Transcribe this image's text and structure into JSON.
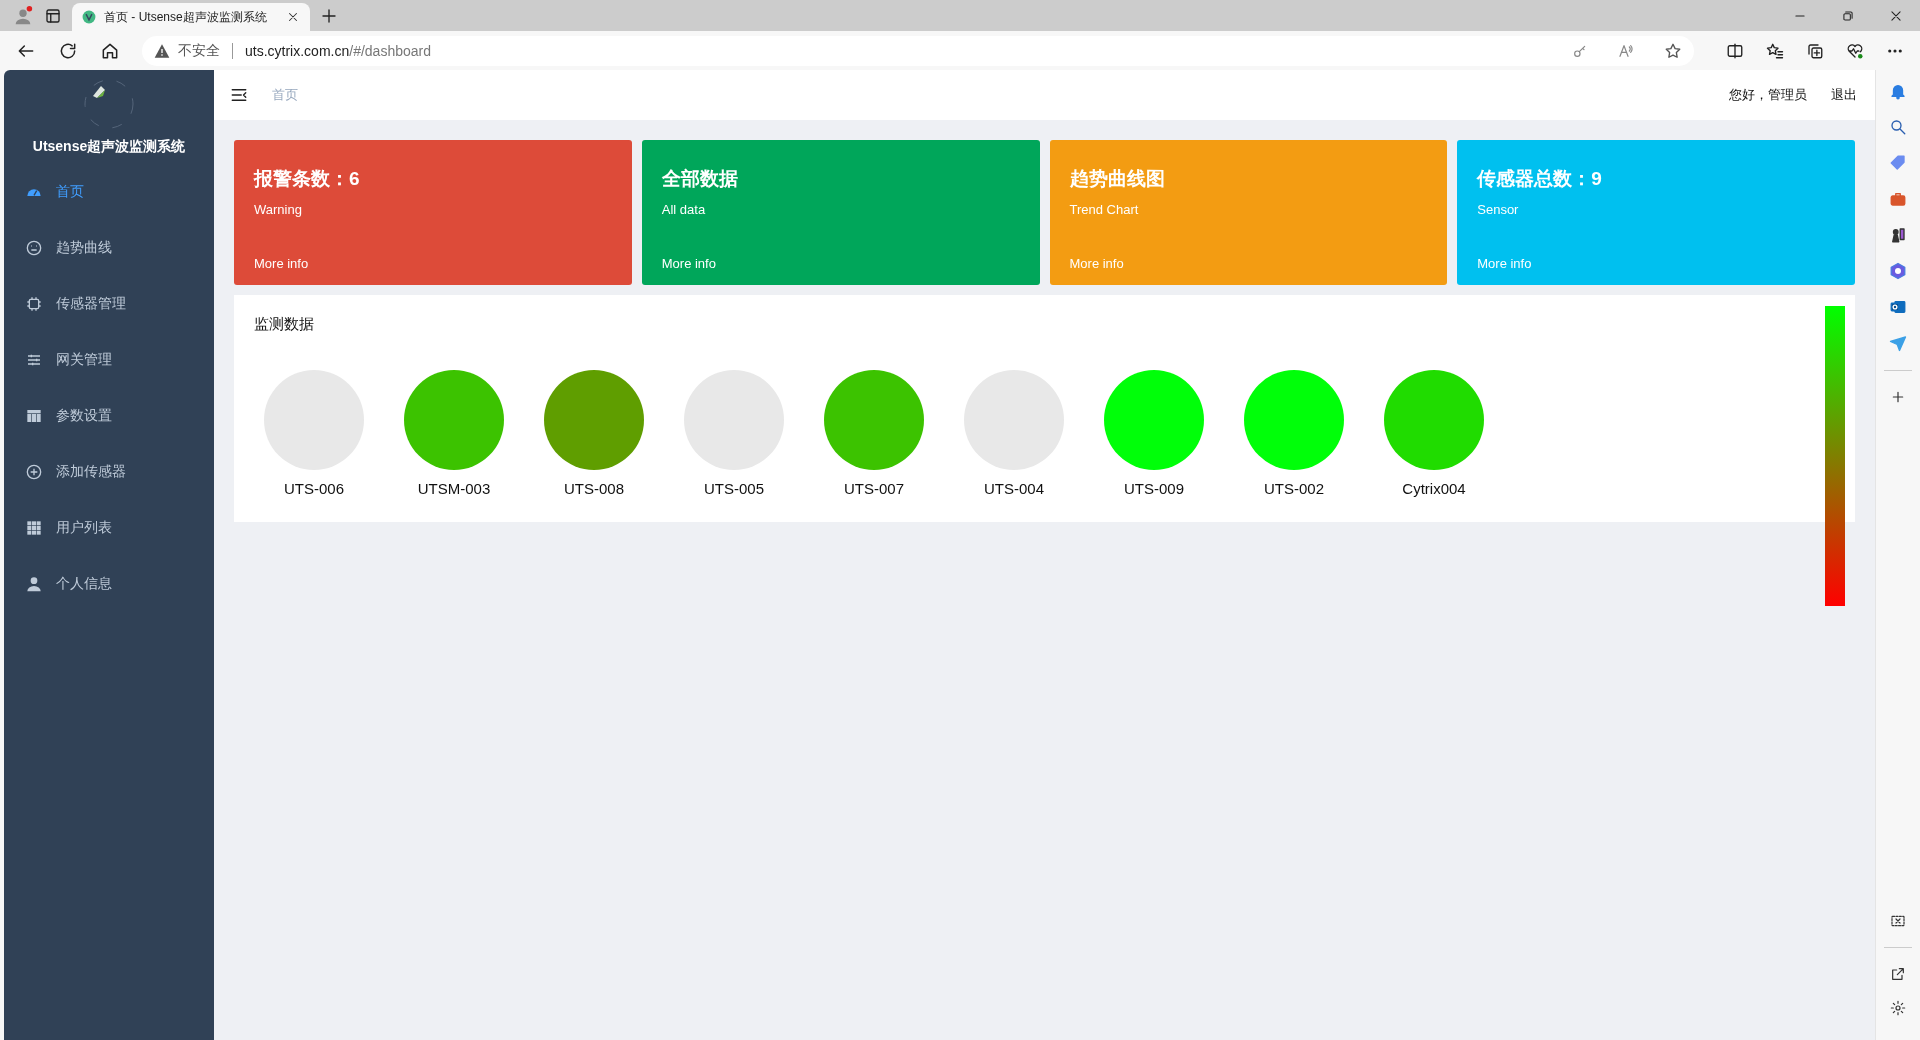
{
  "browser": {
    "tab_title": "首页 - Utsense超声波监测系统",
    "security": "不安全",
    "url_host": "uts.cytrix.com.cn",
    "url_path": "/#/dashboard"
  },
  "sidebar": {
    "title": "Utsense超声波监测系统",
    "items": [
      {
        "label": "首页",
        "selected": true
      },
      {
        "label": "趋势曲线",
        "selected": false
      },
      {
        "label": "传感器管理",
        "selected": false
      },
      {
        "label": "网关管理",
        "selected": false
      },
      {
        "label": "参数设置",
        "selected": false
      },
      {
        "label": "添加传感器",
        "selected": false
      },
      {
        "label": "用户列表",
        "selected": false
      },
      {
        "label": "个人信息",
        "selected": false
      }
    ]
  },
  "header": {
    "breadcrumb": "首页",
    "greeting": "您好，管理员",
    "logout": "退出"
  },
  "cards": [
    {
      "title": "报警条数：6",
      "subtitle": "Warning",
      "link": "More info",
      "color": "#dd4b39"
    },
    {
      "title": "全部数据",
      "subtitle": "All data",
      "link": "More info",
      "color": "#00a65a"
    },
    {
      "title": "趋势曲线图",
      "subtitle": "Trend Chart",
      "link": "More info",
      "color": "#f39c12"
    },
    {
      "title": "传感器总数：9",
      "subtitle": "Sensor",
      "link": "More info",
      "color": "#00c0ef"
    }
  ],
  "monitor": {
    "title": "监测数据",
    "sensors": [
      {
        "name": "UTS-006",
        "color": "#e8e8e8"
      },
      {
        "name": "UTSM-003",
        "color": "#3cc300"
      },
      {
        "name": "UTS-008",
        "color": "#5f9e00"
      },
      {
        "name": "UTS-005",
        "color": "#e8e8e8"
      },
      {
        "name": "UTS-007",
        "color": "#3cc300"
      },
      {
        "name": "UTS-004",
        "color": "#e8e8e8"
      },
      {
        "name": "UTS-009",
        "color": "#00ff09"
      },
      {
        "name": "UTS-002",
        "color": "#00ff09"
      },
      {
        "name": "Cytrix004",
        "color": "#20dc00"
      }
    ]
  }
}
